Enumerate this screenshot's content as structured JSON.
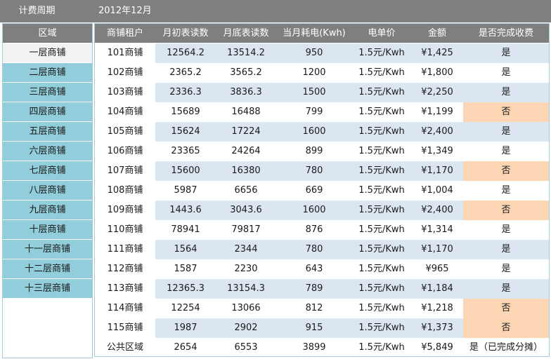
{
  "period": {
    "label": "计费周期",
    "value": "2012年12月"
  },
  "sidebar": {
    "header": "区域",
    "items": [
      "一层商铺",
      "二层商铺",
      "三层商铺",
      "四层商铺",
      "五层商铺",
      "六层商铺",
      "七层商铺",
      "八层商铺",
      "九层商铺",
      "十层商铺",
      "十一层商铺",
      "十二层商铺",
      "十三层商铺"
    ],
    "active_index": 0
  },
  "table": {
    "headers": [
      "商铺租户",
      "月初表读数",
      "月底表读数",
      "当月耗电(Kwh)",
      "电单价",
      "金额",
      "是否完成收费"
    ],
    "rows": [
      [
        "101商铺",
        "12564.2",
        "13514.2",
        "950",
        "1.5元/Kwh",
        "¥1,425",
        "是"
      ],
      [
        "102商铺",
        "2365.2",
        "3565.2",
        "1200",
        "1.5元/Kwh",
        "¥1,800",
        "是"
      ],
      [
        "103商铺",
        "2336.3",
        "3836.3",
        "1500",
        "1.5元/Kwh",
        "¥2,250",
        "是"
      ],
      [
        "104商铺",
        "15689",
        "16488",
        "799",
        "1.5元/Kwh",
        "¥1,199",
        "否"
      ],
      [
        "105商铺",
        "15624",
        "17224",
        "1600",
        "1.5元/Kwh",
        "¥2,400",
        "是"
      ],
      [
        "106商铺",
        "23365",
        "24264",
        "899",
        "1.5元/Kwh",
        "¥1,349",
        "是"
      ],
      [
        "107商铺",
        "15600",
        "16380",
        "780",
        "1.5元/Kwh",
        "¥1,170",
        "否"
      ],
      [
        "108商铺",
        "5987",
        "6656",
        "669",
        "1.5元/Kwh",
        "¥1,004",
        "是"
      ],
      [
        "109商铺",
        "1443.6",
        "3043.6",
        "1600",
        "1.5元/Kwh",
        "¥2,400",
        "否"
      ],
      [
        "110商铺",
        "78941",
        "79817",
        "876",
        "1.5元/Kwh",
        "¥1,314",
        "是"
      ],
      [
        "111商铺",
        "1564",
        "2344",
        "780",
        "1.5元/Kwh",
        "¥1,170",
        "是"
      ],
      [
        "112商铺",
        "1587",
        "2230",
        "643",
        "1.5元/Kwh",
        "¥965",
        "是"
      ],
      [
        "113商铺",
        "12365.3",
        "13154.3",
        "789",
        "1.5元/Kwh",
        "¥1,184",
        "是"
      ],
      [
        "114商铺",
        "12254",
        "13066",
        "812",
        "1.5元/Kwh",
        "¥1,218",
        "否"
      ],
      [
        "115商铺",
        "1987",
        "2902",
        "915",
        "1.5元/Kwh",
        "¥1,373",
        "否"
      ],
      [
        "公共区域",
        "2654",
        "6553",
        "3899",
        "1.5元/Kwh",
        "¥5,849",
        "是（已完成分摊）"
      ]
    ]
  },
  "colors": {
    "header_bg": "#7f7f7f",
    "sidebar_item_bg": "#92cddc",
    "sidebar_active_bg": "#f2f2f2",
    "row_stripe": "#dce6f1",
    "unpaid_highlight": "#fcd5b4"
  }
}
